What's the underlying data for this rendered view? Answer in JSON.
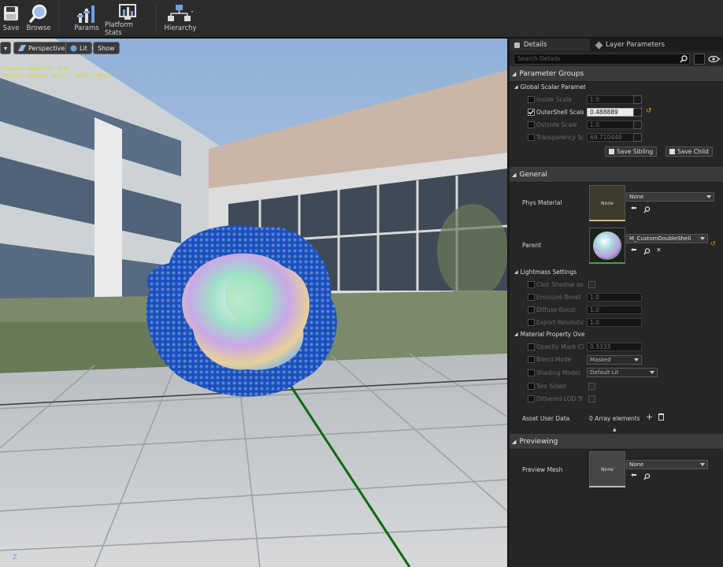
{
  "toolbar": {
    "save": "Save",
    "browse": "Browse",
    "params": "Params",
    "platform_stats": "Platform Stats",
    "hierarchy": "Hierarchy"
  },
  "viewport": {
    "menu_button": "▾",
    "perspective": "Perspective",
    "lit": "Lit",
    "show": "Show",
    "stats": [
      "Texture samplers: 4/16",
      "Texture Lookups (Est.): VS(0), PS(2)"
    ],
    "axis": "Z"
  },
  "tabs": {
    "details": "Details",
    "layer_parameters": "Layer Parameters"
  },
  "search": {
    "placeholder": "Search Details"
  },
  "parameter_groups": {
    "title": "Parameter Groups",
    "group_label": "Global Scalar Parameter Values",
    "params": [
      {
        "name": "Inside Scale",
        "value": "1.0",
        "enabled": false
      },
      {
        "name": "OuterShell Scale",
        "value": "0.488889",
        "enabled": true
      },
      {
        "name": "Outside Scale",
        "value": "1.0",
        "enabled": false
      },
      {
        "name": "Transparency Scale",
        "value": "69.710449",
        "enabled": false
      }
    ],
    "save_sibling": "Save Sibling",
    "save_child": "Save Child"
  },
  "general": {
    "title": "General",
    "phys_material_label": "Phys Material",
    "phys_material_thumb": "None",
    "phys_material_value": "None",
    "parent_label": "Parent",
    "parent_value": "M_CustomDoubleShell",
    "lightmass_label": "Lightmass Settings",
    "lightmass": [
      {
        "name": "Cast Shadow as Masked",
        "value": ""
      },
      {
        "name": "Emissive Boost",
        "value": "1.0"
      },
      {
        "name": "Diffuse Boost",
        "value": "1.0"
      },
      {
        "name": "Export Resolution Scale",
        "value": "1.0"
      }
    ],
    "overrides_label": "Material Property Overrides",
    "overrides": [
      {
        "name": "Opacity Mask Clip Value",
        "value": "0.3333"
      },
      {
        "name": "Blend Mode",
        "value": "Masked"
      },
      {
        "name": "Shading Model",
        "value": "Default Lit"
      },
      {
        "name": "Two Sided",
        "value": ""
      },
      {
        "name": "Dithered LOD Transition",
        "value": ""
      }
    ],
    "asset_user_data_label": "Asset User Data",
    "asset_user_data_value": "0 Array elements"
  },
  "previewing": {
    "title": "Previewing",
    "preview_mesh_label": "Preview Mesh",
    "preview_mesh_thumb": "None",
    "preview_mesh_value": "None"
  },
  "colors": {
    "panel_bg": "#262626",
    "header_bg": "#3b3b3b",
    "toolbar_bg": "#2c2c2c",
    "accent": "#e6a800",
    "grid_green": "#0c6a10"
  }
}
